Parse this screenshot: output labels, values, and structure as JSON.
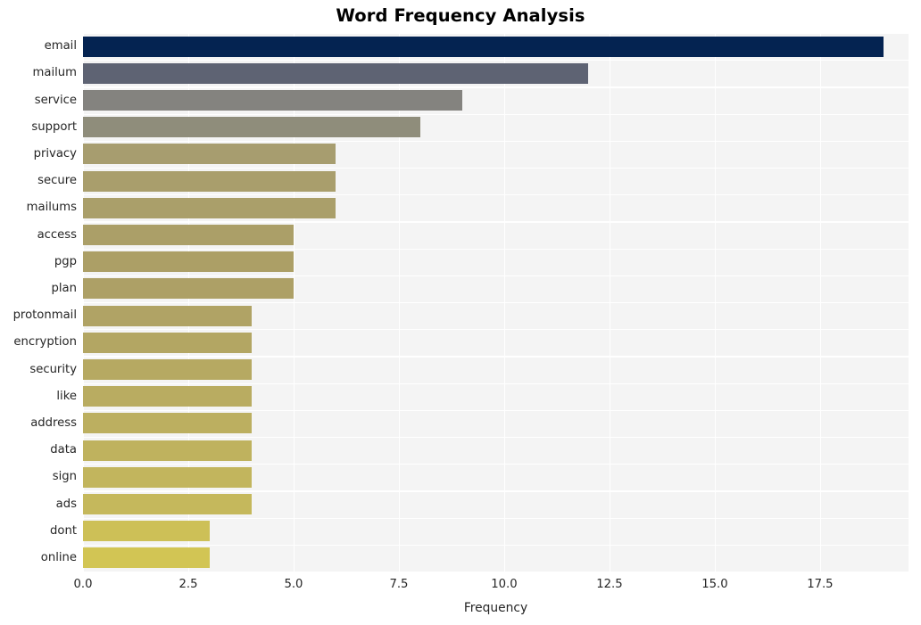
{
  "chart_data": {
    "type": "bar",
    "orientation": "horizontal",
    "title": "Word Frequency Analysis",
    "xlabel": "Frequency",
    "ylabel": "",
    "categories": [
      "email",
      "mailum",
      "service",
      "support",
      "privacy",
      "secure",
      "mailums",
      "access",
      "pgp",
      "plan",
      "protonmail",
      "encryption",
      "security",
      "like",
      "address",
      "data",
      "sign",
      "ads",
      "dont",
      "online"
    ],
    "values": [
      19,
      12,
      9,
      8,
      6,
      6,
      6,
      5,
      5,
      5,
      4,
      4,
      4,
      4,
      4,
      4,
      4,
      4,
      3,
      3
    ],
    "bar_colors": [
      "#042351",
      "#5e6373",
      "#84837f",
      "#8f8d7b",
      "#a79d6f",
      "#a99e6c",
      "#aa9f6a",
      "#ab9f68",
      "#ac9f66",
      "#ada066",
      "#b0a365",
      "#b3a663",
      "#b6a962",
      "#b9ac61",
      "#bcaf60",
      "#bfb25e",
      "#c2b55d",
      "#c5b85c",
      "#cdc057",
      "#d2c554"
    ],
    "xticks": [
      "0.0",
      "2.5",
      "5.0",
      "7.5",
      "10.0",
      "12.5",
      "15.0",
      "17.5"
    ],
    "xtick_values": [
      0,
      2.5,
      5,
      7.5,
      10,
      12.5,
      15,
      17.5
    ],
    "xlim": [
      0,
      19.6
    ],
    "grid": true,
    "legend": "none",
    "plot_background": "#f4f4f4",
    "gridline_color": "#ffffff",
    "figure_background": "#ffffff"
  }
}
